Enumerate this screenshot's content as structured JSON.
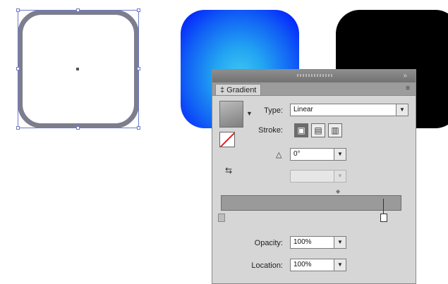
{
  "canvas": {
    "shapes": [
      {
        "name": "white-rounded-square",
        "fill": "#ffffff",
        "stroke": "#7c7e8e",
        "selected": true
      },
      {
        "name": "blue-gradient-rounded-square",
        "fill": "radial #3fc6f2 to #0010ff"
      },
      {
        "name": "black-rounded-square",
        "fill": "#000000"
      }
    ]
  },
  "panel": {
    "tab_label": "‡ Gradient",
    "close_glyph": "»",
    "menu_glyph": "≡",
    "type_label": "Type:",
    "type_value": "Linear",
    "stroke_label": "Stroke:",
    "angle_value": "0°",
    "aspect_value": "",
    "opacity_label": "Opacity:",
    "opacity_value": "100%",
    "location_label": "Location:",
    "location_value": "100%",
    "dropdown_arrow": "▼",
    "swatch_arrow": "▼",
    "angle_icon": "△",
    "reverse_icon": "⇆",
    "midpoint_glyph": "◆",
    "stroke_buttons": [
      "▣",
      "▤",
      "▥"
    ]
  },
  "colors": {
    "panel_bg": "#d6d6d6",
    "selection_blue": "#6f78cc",
    "gradient_ramp": "#9a9a9a"
  }
}
